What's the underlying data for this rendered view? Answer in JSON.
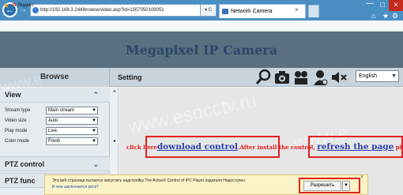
{
  "browser": {
    "back": "←",
    "forward": "→",
    "address": "http://192.168.3.244/browse/video.asp?id=1507050109051",
    "address_ctrl": "▾ C",
    "tab_title": "Network Camera",
    "tab_close": "×",
    "win_min": "—",
    "win_max": "□",
    "win_close": "×",
    "favorite": "Яндекс"
  },
  "page": {
    "title": "Megapixel IP Camera",
    "tabs": {
      "browse": "Browse",
      "setting": "Setting"
    },
    "language": "English"
  },
  "sidebar": {
    "view_title": "View",
    "view_rows": [
      {
        "label": "Stream type",
        "value": "Main stream"
      },
      {
        "label": "Video size",
        "value": "Auto"
      },
      {
        "label": "Play mode",
        "value": "Live"
      },
      {
        "label": "Color mode",
        "value": "Fresh"
      }
    ],
    "ptz_control": "PTZ control",
    "ptz_function": "PTZ func"
  },
  "main": {
    "msg_pre": "click here",
    "download_link": "download control",
    "msg_mid": ".After install the control, ",
    "refresh_link": "refresh the page",
    "msg_post": " please."
  },
  "notification": {
    "text": "Эта веб-страница пытается запустить надстройку The ActiveX Control of IPC Player издателя Недоступен.",
    "link": "В чем заключается риск?",
    "allow": "Разрешить"
  },
  "watermark": "www.esocctv.ru",
  "colors": {
    "banner": "#5a6f80",
    "title": "#2a4866",
    "alert": "#e31c1c",
    "link": "#2a3fb0"
  }
}
